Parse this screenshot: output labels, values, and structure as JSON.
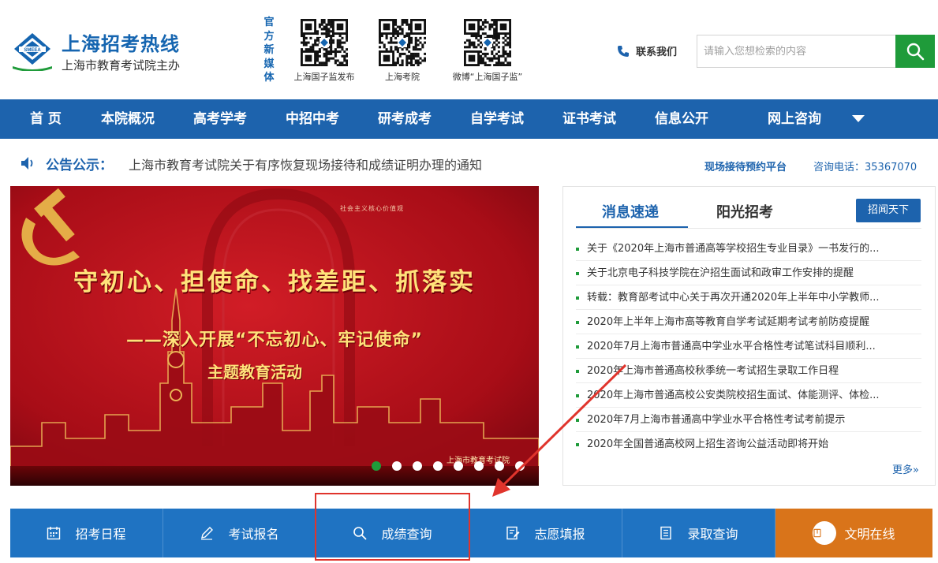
{
  "header": {
    "logo_title": "上海招考热线",
    "logo_sub": "上海市教育考试院主办",
    "media_label": [
      "官",
      "方",
      "新",
      "媒",
      "体"
    ],
    "qr_codes": [
      {
        "caption": "上海国子监发布"
      },
      {
        "caption": "上海考院"
      },
      {
        "caption": "微博“上海国子监”"
      }
    ],
    "contact_label": "联系我们",
    "search_placeholder": "请输入您想检索的内容"
  },
  "nav": {
    "items": [
      "首 页",
      "本院概况",
      "高考学考",
      "中招中考",
      "研考成考",
      "自学考试",
      "证书考试",
      "信息公开",
      "网上咨询"
    ]
  },
  "notice": {
    "label": "公告公示：",
    "message": "上海市教育考试院关于有序恢复现场接待和成绩证明办理的通知",
    "platform_link": "现场接待预约平台",
    "phone": "咨询电话：35367070"
  },
  "banner": {
    "line1": "守初心、担使命、找差距、抓落实",
    "line2": "——深入开展“不忘初心、牢记使命”",
    "line3": "主题教育活动",
    "org": "上海市教育考试院",
    "slide_count": 8,
    "active_slide": 0
  },
  "news": {
    "tabs": [
      "消息速递",
      "阳光招考"
    ],
    "active_tab": 0,
    "feature_button": "招闻天下",
    "items": [
      "关于《2020年上海市普通高等学校招生专业目录》一书发行的...",
      "关于北京电子科技学院在沪招生面试和政审工作安排的提醒",
      "转载：教育部考试中心关于再次开通2020年上半年中小学教师...",
      "2020年上半年上海市高等教育自学考试延期考试考前防疫提醒",
      "2020年7月上海市普通高中学业水平合格性考试笔试科目顺利...",
      "2020年上海市普通高校秋季统一考试招生录取工作日程",
      "2020年上海市普通高校公安类院校招生面试、体能测评、体检...",
      "2020年7月上海市普通高中学业水平合格性考试考前提示",
      "2020年全国普通高校网上招生咨询公益活动即将开始"
    ],
    "more_label": "更多»"
  },
  "quick_links": [
    {
      "label": "招考日程",
      "icon": "calendar-icon"
    },
    {
      "label": "考试报名",
      "icon": "pen-icon"
    },
    {
      "label": "成绩查询",
      "icon": "search-icon"
    },
    {
      "label": "志愿填报",
      "icon": "form-edit-icon"
    },
    {
      "label": "录取查询",
      "icon": "document-icon"
    },
    {
      "label": "文明在线",
      "icon": "book-icon"
    }
  ],
  "colors": {
    "brand_blue": "#1d63ad",
    "accent_green": "#1f9b3a",
    "quick_blue": "#1f73c2",
    "quick_orange": "#d9741a",
    "annotation_red": "#e0342c"
  }
}
